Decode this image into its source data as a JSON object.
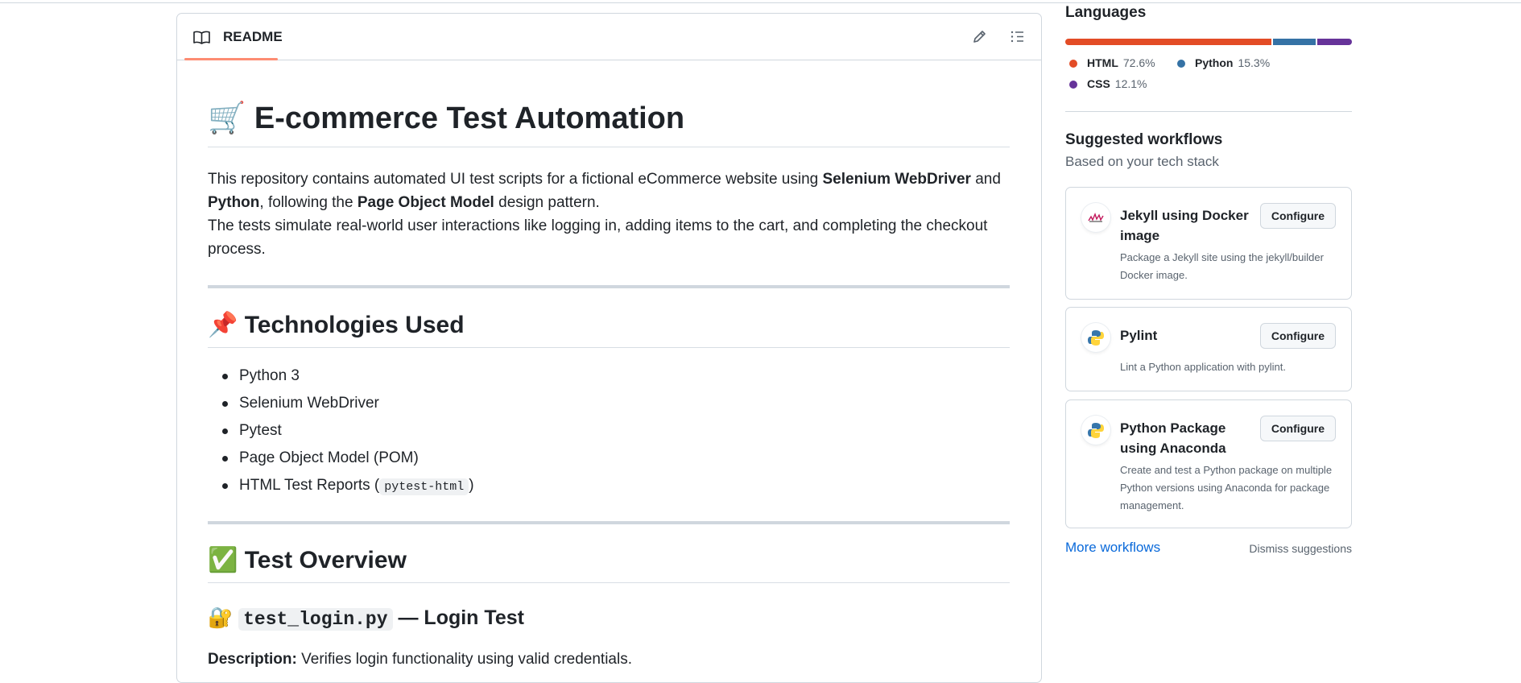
{
  "readme": {
    "tab_label": "README",
    "title_emoji": "🛒",
    "title": "E-commerce Test Automation",
    "intro": {
      "line1_a": "This repository contains automated UI test scripts for a fictional eCommerce website using ",
      "selenium": "Selenium WebDriver",
      "line1_b": " and",
      "python": "Python",
      "line2_a": ", following the ",
      "pom": "Page Object Model",
      "line2_b": " design pattern.",
      "line3": "The tests simulate real-world user interactions like logging in, adding items to the cart, and completing the checkout",
      "line4": "process."
    },
    "tech_heading_emoji": "📌",
    "tech_heading": "Technologies Used",
    "tech_items": [
      "Python 3",
      "Selenium WebDriver",
      "Pytest",
      "Page Object Model (POM)"
    ],
    "tech_last_prefix": "HTML Test Reports (",
    "tech_last_code": "pytest-html",
    "tech_last_suffix": ")",
    "overview_emoji": "✅",
    "overview_heading": "Test Overview",
    "login_emoji": "🔐",
    "login_code": "test_login.py",
    "login_title": " — Login Test",
    "desc_label": "Description:",
    "desc_text": " Verifies login functionality using valid credentials."
  },
  "sidebar": {
    "languages_title": "Languages",
    "languages": [
      {
        "name": "HTML",
        "percent": "72.6%",
        "color": "#e34c26",
        "share": 72.6
      },
      {
        "name": "Python",
        "percent": "15.3%",
        "color": "#3572a5",
        "share": 15.3
      },
      {
        "name": "CSS",
        "percent": "12.1%",
        "color": "#663399",
        "share": 12.1
      }
    ],
    "suggested_title": "Suggested workflows",
    "suggested_sub": "Based on your tech stack",
    "workflows": [
      {
        "title": "Jekyll using Docker image",
        "desc": "Package a Jekyll site using the jekyll/builder Docker image.",
        "button": "Configure",
        "icon": "jekyll-icon"
      },
      {
        "title": "Pylint",
        "desc": "Lint a Python application with pylint.",
        "button": "Configure",
        "icon": "python-icon"
      },
      {
        "title": "Python Package using Anaconda",
        "desc": "Create and test a Python package on multiple Python versions using Anaconda for package management.",
        "button": "Configure",
        "icon": "python-icon"
      }
    ],
    "more_workflows": "More workflows",
    "dismiss": "Dismiss suggestions"
  }
}
